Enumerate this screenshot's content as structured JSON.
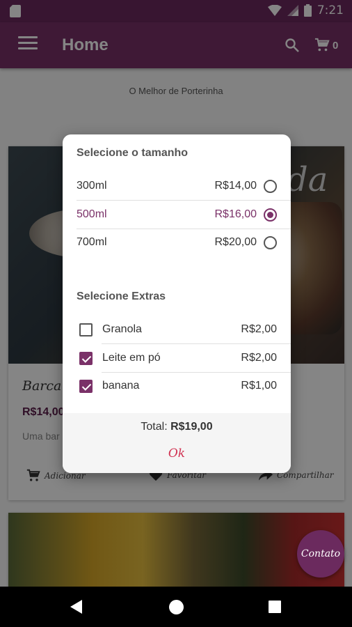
{
  "status_bar": {
    "time": "7:21"
  },
  "app_bar": {
    "title": "Home",
    "cart_count": "0"
  },
  "page": {
    "subtitle": "O Melhor de Porterinha",
    "card": {
      "title": "Barca",
      "price": "R$14,00",
      "description": "Uma bar",
      "actions": {
        "add": "Adicionar",
        "favorite": "Favoritar",
        "share": "Compartilhar"
      }
    },
    "fab_label": "Contato"
  },
  "dialog": {
    "size_title": "Selecione o tamanho",
    "sizes": [
      {
        "label": "300ml",
        "price": "R$14,00",
        "selected": false
      },
      {
        "label": "500ml",
        "price": "R$16,00",
        "selected": true
      },
      {
        "label": "700ml",
        "price": "R$20,00",
        "selected": false
      }
    ],
    "extras_title": "Selecione Extras",
    "extras": [
      {
        "label": "Granola",
        "price": "R$2,00",
        "checked": false
      },
      {
        "label": "Leite em pó",
        "price": "R$2,00",
        "checked": true
      },
      {
        "label": "banana",
        "price": "R$1,00",
        "checked": true
      }
    ],
    "total_label": "Total:",
    "total_value": "R$19,00",
    "ok_label": "Ok"
  },
  "colors": {
    "primary": "#7a3168",
    "status_bar": "#6b2a5e",
    "ok_text": "#d03050"
  }
}
